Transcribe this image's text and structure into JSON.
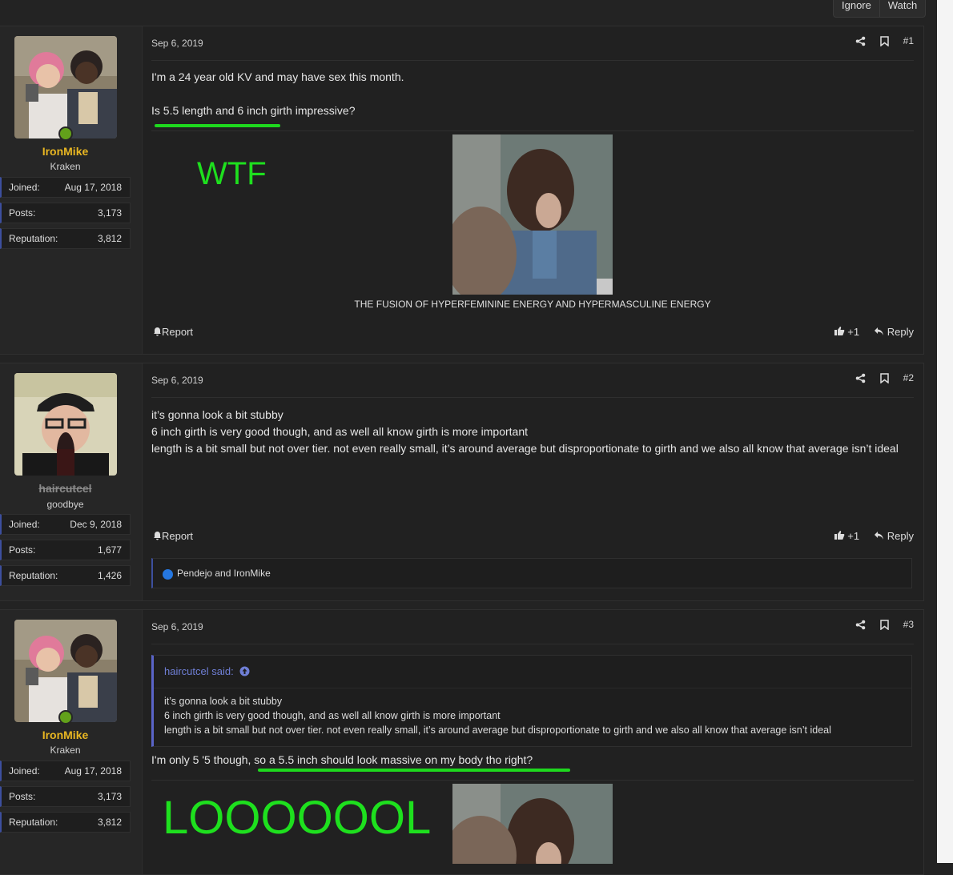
{
  "header": {
    "ignore_label": "Ignore",
    "watch_label": "Watch"
  },
  "posts": [
    {
      "date": "Sep 6, 2019",
      "number": "#1",
      "user": {
        "name": "IronMike",
        "title": "Kraken",
        "joined_label": "Joined:",
        "joined": "Aug 17, 2018",
        "posts_label": "Posts:",
        "posts": "3,173",
        "rep_label": "Reputation:",
        "rep": "3,812"
      },
      "lines": [
        "I'm a 24 year old KV and may have sex this month.",
        "Is 5.5 length and 6 inch girth impressive?"
      ],
      "overlay_text": "WTF",
      "caption": "THE FUSION OF HYPERFEMININE ENERGY AND HYPERMASCULINE ENERGY",
      "report_label": "Report",
      "like_label": "+1",
      "reply_label": "Reply"
    },
    {
      "date": "Sep 6, 2019",
      "number": "#2",
      "user": {
        "name": "haircutcel",
        "title": "goodbye",
        "joined_label": "Joined:",
        "joined": "Dec 9, 2018",
        "posts_label": "Posts:",
        "posts": "1,677",
        "rep_label": "Reputation:",
        "rep": "1,426"
      },
      "lines": [
        "it’s gonna look a bit stubby",
        "6 inch girth is very good though, and as well all know girth is more important",
        "length is a bit small but not over tier. not even really small, it’s around average but disproportionate to girth and we also all know that average isn’t ideal"
      ],
      "report_label": "Report",
      "like_label": "+1",
      "reply_label": "Reply",
      "reactions": "Pendejo and IronMike"
    },
    {
      "date": "Sep 6, 2019",
      "number": "#3",
      "user": {
        "name": "IronMike",
        "title": "Kraken",
        "joined_label": "Joined:",
        "joined": "Aug 17, 2018",
        "posts_label": "Posts:",
        "posts": "3,173",
        "rep_label": "Reputation:",
        "rep": "3,812"
      },
      "quote": {
        "author": "haircutcel said:",
        "lines": [
          "it’s gonna look a bit stubby",
          "6 inch girth is very good though, and as well all know girth is more important",
          "length is a bit small but not over tier. not even really small, it’s around average but disproportionate to girth and we also all know that average isn’t ideal"
        ]
      },
      "lines": [
        "I'm only 5 '5 though, so a 5.5 inch should look massive on my body tho right?"
      ],
      "overlay_text": "LOOOOOOL"
    }
  ],
  "colors": {
    "accent_green": "#1ee01e",
    "username": "#e8b622",
    "quote_link": "#6f7fd6",
    "stat_border": "#3d4f9e"
  },
  "icons": [
    "share-icon",
    "bookmark-icon",
    "bell-icon",
    "thumbs-up-icon",
    "reply-icon",
    "arrow-up-circle-icon",
    "online-dot-icon"
  ]
}
